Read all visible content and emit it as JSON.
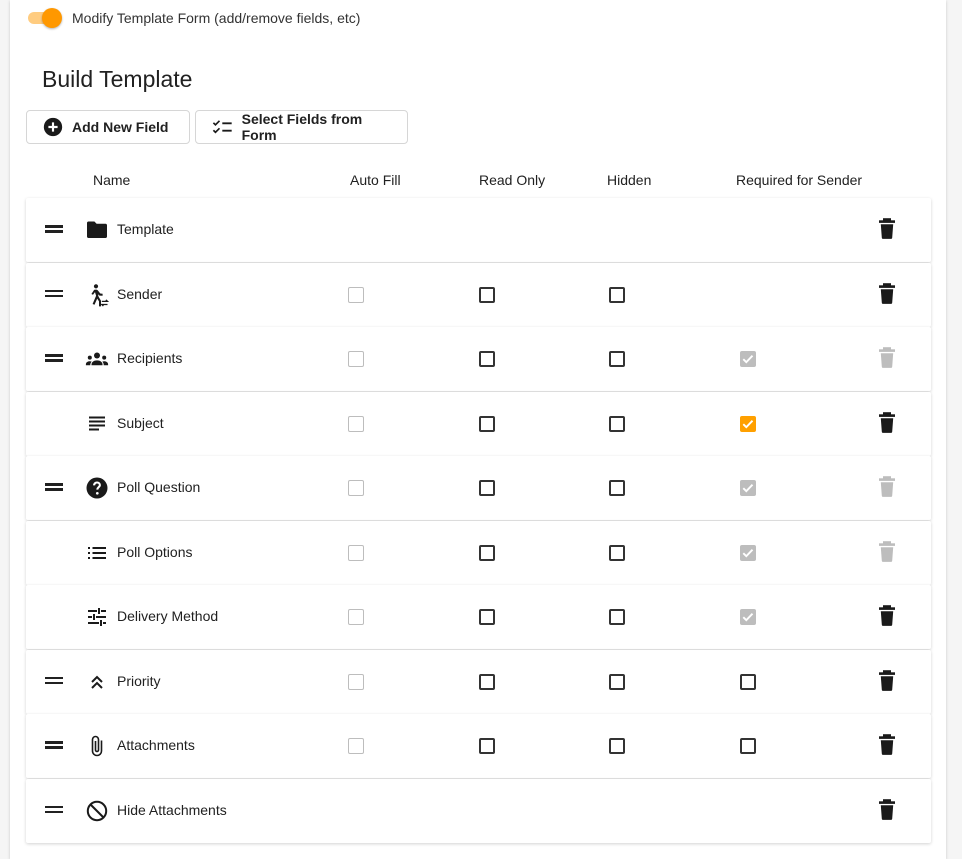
{
  "toggle": {
    "label": "Modify Template Form (add/remove fields, etc)",
    "on": true
  },
  "title": "Build Template",
  "buttons": {
    "add_new_field": "Add New Field",
    "select_fields": "Select Fields from Form"
  },
  "columns": [
    "Name",
    "Auto Fill",
    "Read Only",
    "Hidden",
    "Required for Sender"
  ],
  "colors": {
    "accent": "#ff9800",
    "accent_light": "#ffcc80",
    "disabled": "#bdbdbd"
  },
  "rows": [
    {
      "name": "Template",
      "icon": "folder-icon",
      "draggable": true,
      "checkboxes": null,
      "delete_enabled": true
    },
    {
      "name": "Sender",
      "icon": "sender-icon",
      "draggable": true,
      "checkboxes": [
        "disabled",
        "unchecked",
        "unchecked",
        null
      ],
      "delete_enabled": true
    },
    {
      "name": "Recipients",
      "icon": "groups-icon",
      "draggable": true,
      "checkboxes": [
        "disabled",
        "unchecked",
        "unchecked",
        "checked-disabled"
      ],
      "delete_enabled": false
    },
    {
      "name": "Subject",
      "icon": "subject-icon",
      "draggable": false,
      "checkboxes": [
        "disabled",
        "unchecked",
        "unchecked",
        "checked"
      ],
      "delete_enabled": true
    },
    {
      "name": "Poll Question",
      "icon": "help-icon",
      "draggable": true,
      "checkboxes": [
        "disabled",
        "unchecked",
        "unchecked",
        "checked-disabled"
      ],
      "delete_enabled": false
    },
    {
      "name": "Poll Options",
      "icon": "list-icon",
      "draggable": false,
      "checkboxes": [
        "disabled",
        "unchecked",
        "unchecked",
        "checked-disabled"
      ],
      "delete_enabled": false
    },
    {
      "name": "Delivery Method",
      "icon": "tune-icon",
      "draggable": false,
      "checkboxes": [
        "disabled",
        "unchecked",
        "unchecked",
        "checked-disabled"
      ],
      "delete_enabled": true
    },
    {
      "name": "Priority",
      "icon": "chevron-double-up-icon",
      "draggable": true,
      "checkboxes": [
        "disabled",
        "unchecked",
        "unchecked",
        "unchecked"
      ],
      "delete_enabled": true
    },
    {
      "name": "Attachments",
      "icon": "paperclip-icon",
      "draggable": true,
      "checkboxes": [
        "disabled",
        "unchecked",
        "unchecked",
        "unchecked"
      ],
      "delete_enabled": true
    },
    {
      "name": "Hide Attachments",
      "icon": "block-icon",
      "draggable": true,
      "checkboxes": null,
      "delete_enabled": true
    }
  ]
}
